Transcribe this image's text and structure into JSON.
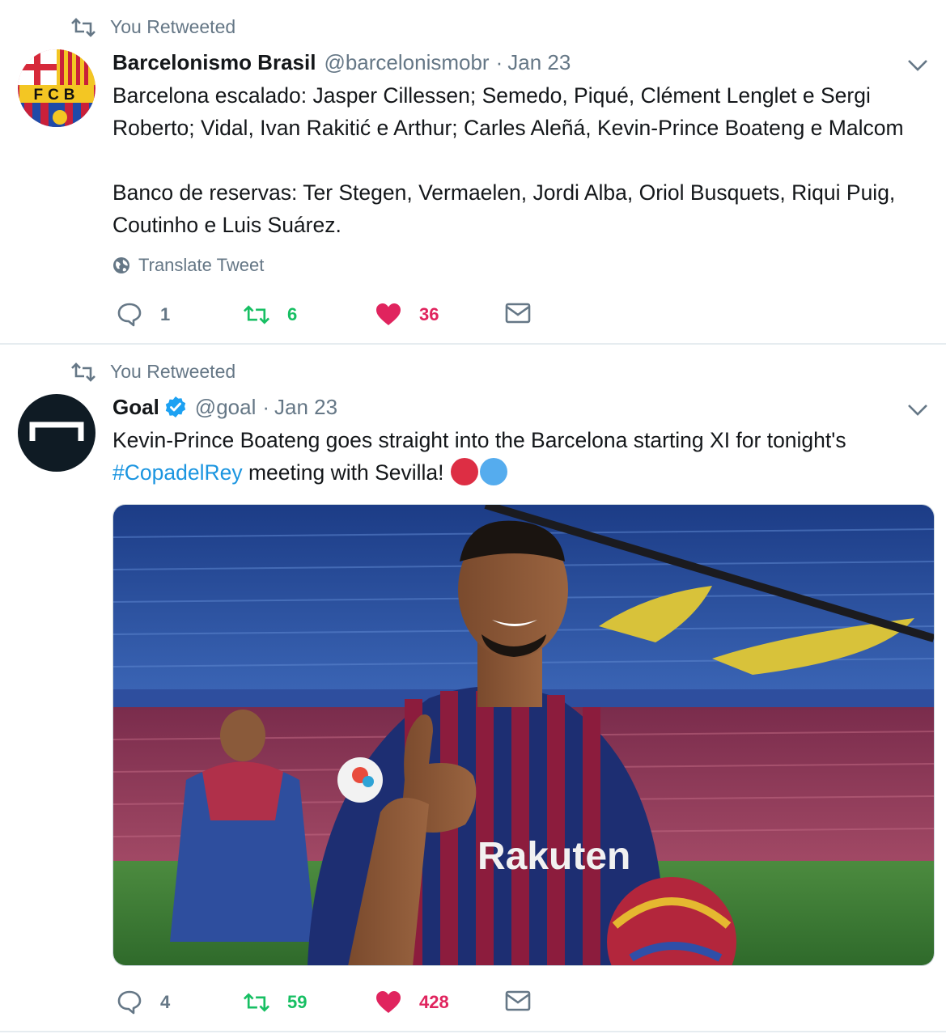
{
  "tweets": [
    {
      "retweet_context": "You Retweeted",
      "display_name": "Barcelonismo Brasil",
      "handle": "@barcelonismobr",
      "separator": "·",
      "date": "Jan 23",
      "avatar_icon": "fcb-crest-icon",
      "avatar_text": "FCB",
      "text": "Barcelona escalado: Jasper Cillessen; Semedo, Piqué, Clément Lenglet e Sergi Roberto; Vidal, Ivan Rakitić e Arthur; Carles Aleñá, Kevin-Prince Boateng e Malcom\n\nBanco de reservas: Ter Stegen, Vermaelen, Jordi Alba, Oriol Busquets, Riqui Puig, Coutinho e Luis Suárez.",
      "translate_label": "Translate Tweet",
      "counts": {
        "replies": "1",
        "retweets": "6",
        "likes": "36"
      },
      "liked": true,
      "retweeted": true
    },
    {
      "retweet_context": "You Retweeted",
      "display_name": "Goal",
      "verified": true,
      "handle": "@goal",
      "separator": "·",
      "date": "Jan 23",
      "avatar_icon": "goal-logo-icon",
      "text_main": "Kevin-Prince Boateng goes straight into the Barcelona starting XI for tonight's",
      "hashtag": "#CopadelRey",
      "text_after": " meeting with Sevilla! ",
      "emoji_icons": [
        "red-circle-icon",
        "blue-circle-icon"
      ],
      "media_icon": "player-thumbs-up-stadium-photo",
      "media_text": "Rakuten",
      "counts": {
        "replies": "4",
        "retweets": "59",
        "likes": "428"
      },
      "liked": true,
      "retweeted": true
    }
  ],
  "colors": {
    "like": "#e0245e",
    "retweet": "#17bf63",
    "link": "#1b95e0",
    "muted": "#657786",
    "emoji_red": "#dd2e44",
    "emoji_blue": "#55acee"
  }
}
